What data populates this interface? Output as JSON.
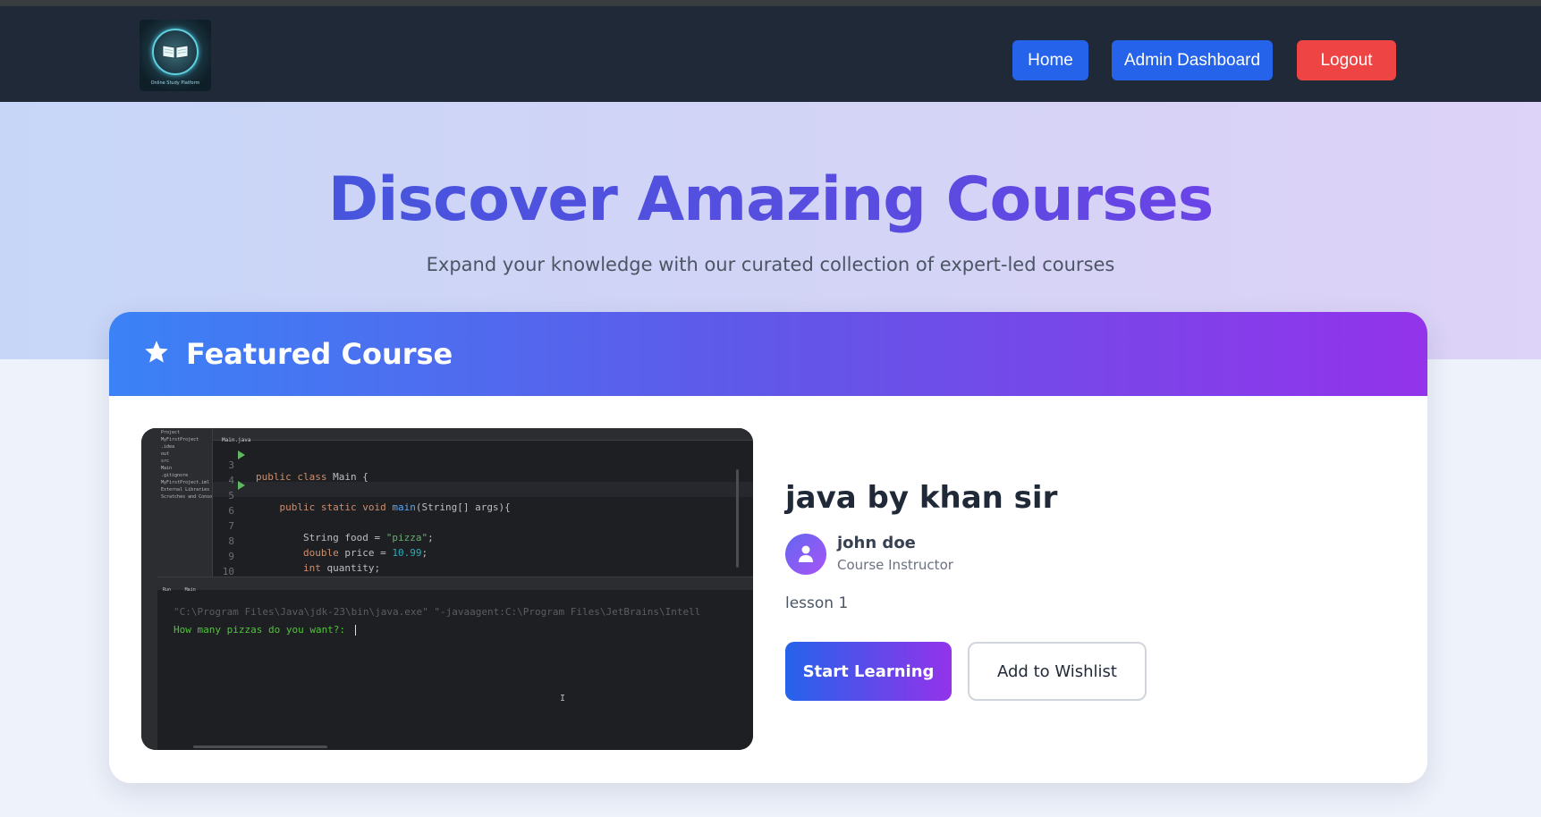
{
  "navbar": {
    "logo_alt": "Logo",
    "logo_caption": "Online Study Platform",
    "home_label": "Home",
    "admin_label": "Admin Dashboard",
    "logout_label": "Logout"
  },
  "hero": {
    "title": "Discover Amazing Courses",
    "subtitle": "Expand your knowledge with our curated collection of expert-led courses"
  },
  "featured": {
    "header": "Featured Course",
    "course_title": "java by khan sir",
    "instructor_name": "john doe",
    "instructor_role": "Course Instructor",
    "lesson": "lesson 1",
    "start_label": "Start Learning",
    "wishlist_label": "Add to Wishlist"
  },
  "thumbnail": {
    "tab": "Main.java",
    "project_tree": [
      "Project",
      "MyFirstProject",
      ".idea",
      "out",
      "src",
      "Main",
      ".gitignore",
      "MyFirstProject.iml",
      "External Libraries",
      "Scratches and Conso"
    ],
    "run_tab": "Run",
    "run_config": "Main",
    "console_cmd": "\"C:\\Program Files\\Java\\jdk-23\\bin\\java.exe\" \"-javaagent:C:\\Program Files\\JetBrains\\Intell",
    "console_prompt": "How many pizzas do you want?: "
  },
  "colors": {
    "nav_bg": "#1f2937",
    "primary": "#2563eb",
    "danger": "#ef4444",
    "accent_purple": "#9333ea"
  },
  "icons": {
    "featured": "star-icon",
    "instructor": "user-icon"
  }
}
